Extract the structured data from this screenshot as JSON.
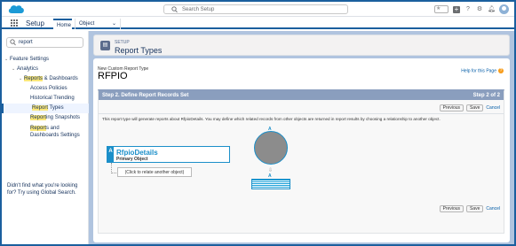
{
  "global_header": {
    "search_placeholder": "Search Setup"
  },
  "app_nav": {
    "app_name": "Setup",
    "tabs": [
      {
        "label": "Home"
      },
      {
        "label": "Object Manager"
      }
    ]
  },
  "sidebar": {
    "quick_find_value": "report",
    "tree": {
      "feature_settings": "Feature Settings",
      "analytics": "Analytics",
      "reports_hl": "Reports",
      "reports_rest": " & Dashboards",
      "access_policies": "Access Policies",
      "historical_trending": "Historical Trending",
      "report_hl": "Report",
      "report_types_rest": " Types",
      "reporting_hl": "Report",
      "reporting_snapshots_rest": "ing Snapshots",
      "reports_dash_settings_hl": "Report",
      "reports_dash_settings_rest": "s and Dashboards Settings"
    },
    "help_text": "Didn't find what you're looking for? Try using Global Search."
  },
  "page_header": {
    "eyebrow": "SETUP",
    "title": "Report Types"
  },
  "content": {
    "new_label": "New Custom Report Type",
    "report_type_name": "RFPIO",
    "help_link": "Help for this Page",
    "step_title": "Step 2. Define Report Records Set",
    "step_count": "Step 2 of 2",
    "buttons": {
      "previous": "Previous",
      "save": "Save",
      "cancel": "Cancel"
    },
    "description": "This report type will generate reports about RfpioDetails. You may define which related records from other objects are returned in report results by choosing a relationship to another object.",
    "primary_object": {
      "badge": "A",
      "name": "RfpioDetails",
      "role": "Primary Object"
    },
    "relate_placeholder": "(Click to relate another object)",
    "diagram_label_top": "A",
    "diagram_label_bottom": "A"
  },
  "colors": {
    "brand": "#1b5f9e",
    "accent": "#1b8fc9",
    "step_bar": "#8a9ebe",
    "highlight": "#fbe77a"
  }
}
